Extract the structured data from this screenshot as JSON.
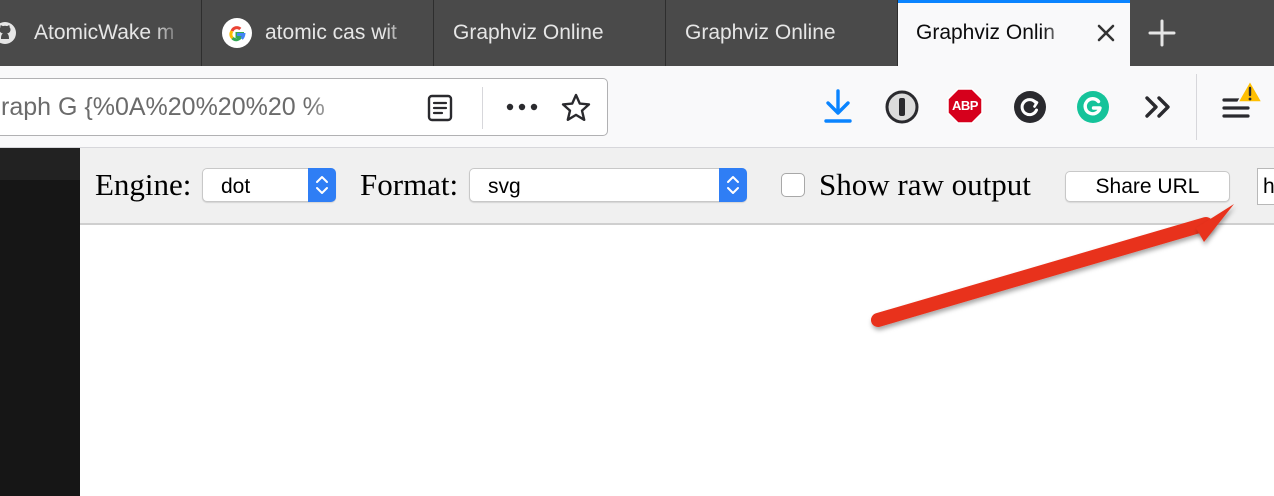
{
  "tabs": [
    {
      "label": "AtomicWake m",
      "favicon": "github-icon"
    },
    {
      "label": "atomic cas wit",
      "favicon": "google-icon"
    },
    {
      "label": "Graphviz Online"
    },
    {
      "label": "Graphviz Online"
    },
    {
      "label": "Graphviz Onlin",
      "active": true,
      "favicon": ""
    }
  ],
  "navbar": {
    "url_text": "raph G {%0A%20%20%20 %",
    "extension_abp_label": "ABP"
  },
  "toolbar": {
    "engine_label": "Engine:",
    "engine_value": "dot",
    "format_label": "Format:",
    "format_value": "svg",
    "raw_output_label": "Show raw output",
    "share_button_label": "Share URL",
    "url_field_value": "h"
  },
  "colors": {
    "accent": "#0a84ff",
    "stepper_blue": "#2f7ef5",
    "annotation_arrow": "#e8311c",
    "abp_red": "#d6001c",
    "grammarly_green": "#15c39a",
    "warning_yellow": "#ffbf00"
  }
}
